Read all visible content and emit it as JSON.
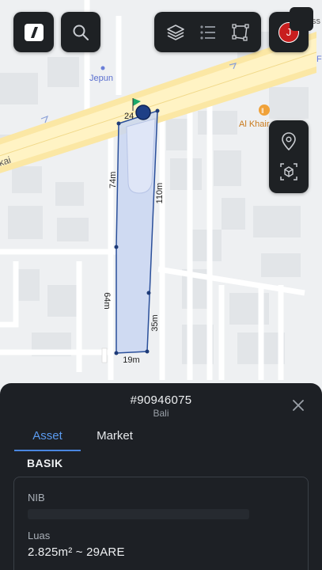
{
  "map": {
    "place_labels": [
      "Jepun",
      "Al Khair"
    ],
    "road_label": "kai",
    "corner_text": "ss",
    "corner_text_2": "Fi",
    "marker_label": "24",
    "dimensions": {
      "top": "24m",
      "left_upper": "74m",
      "right": "110m",
      "left_lower": "64m",
      "right_lower": "35m",
      "bottom": "19m"
    }
  },
  "toolbar": {
    "logo_icon": "app-logo-icon",
    "search_icon": "search-icon",
    "layers_icon": "layers-icon",
    "list_icon": "list-icon",
    "polygon_icon": "polygon-select-icon",
    "avatar_initial": "J",
    "avatar_color": "#c81e1e"
  },
  "side_tools": {
    "location_icon": "location-pin-icon",
    "cube_icon": "3d-cube-icon"
  },
  "sheet": {
    "parcel_id": "#90946075",
    "region": "Bali",
    "tabs": [
      {
        "label": "Asset",
        "active": true
      },
      {
        "label": "Market",
        "active": false
      }
    ],
    "section_title": "BASIK",
    "nib_label": "NIB",
    "luas_label": "Luas",
    "luas_value": "2.825m² ~ 29ARE"
  },
  "colors": {
    "accent": "#4a86e0",
    "polygon_fill": "#c9d6f2",
    "polygon_stroke": "#2a4f9a",
    "sheet_bg": "#1d2025",
    "road": "#fff3c4"
  }
}
